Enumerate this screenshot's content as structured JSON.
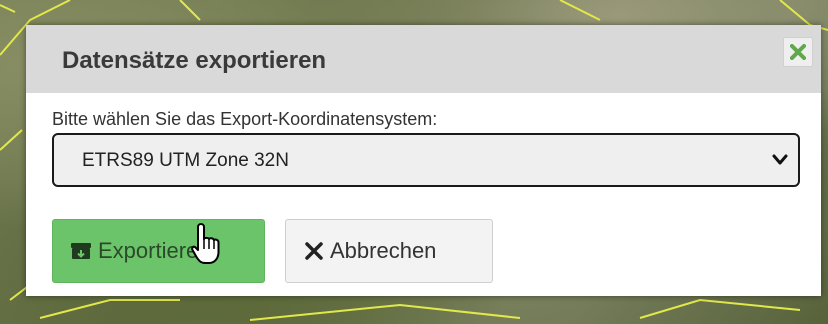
{
  "dialog": {
    "title": "Datensätze exportieren",
    "close_icon": "close-x-icon",
    "prompt": "Bitte wählen Sie das Export-Koordinatensystem:",
    "coordinate_system": {
      "selected": "ETRS89 UTM Zone 32N"
    },
    "buttons": {
      "export": {
        "label": "Exportieren",
        "icon": "export-box-icon"
      },
      "cancel": {
        "label": "Abbrechen",
        "icon": "x-icon"
      }
    }
  },
  "colors": {
    "export_button": "#6cc46a",
    "close_icon": "#5fa84c",
    "parcel_lines": "#e2e84a"
  }
}
